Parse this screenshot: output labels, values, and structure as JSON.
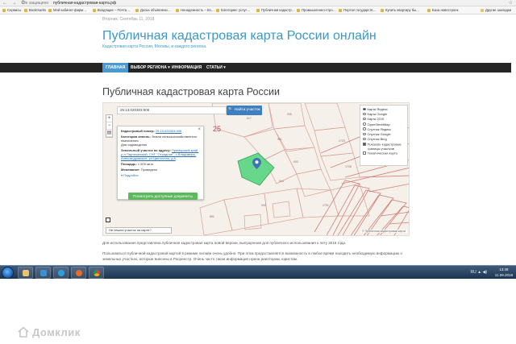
{
  "browser": {
    "nav_glyphs": "← → C",
    "secure_label": "Не защищено",
    "url": "публичная-кадастровая-карта.рф",
    "bookmarks": [
      "Сервисы",
      "Bookmarks",
      "Мой кабинет-фирм…",
      "Входящие – Почта…",
      "Доска объявлени…",
      "Ненадежность – Вз…",
      "Категории: услуг…",
      "Публичная кадастр…",
      "Промышленно-стро…",
      "Портал государств…",
      "Купить квартиру бы…",
      "База новостроек",
      "Другие закладки"
    ]
  },
  "header": {
    "date": "Вторник, Сентябрь 11, 2018",
    "site_title": "Публичная кадастровая карта России онлайн",
    "tagline": "Кадастровая карта России, Москвы, и каждого региона."
  },
  "nav": {
    "items": [
      "ГЛАВНАЯ",
      "ВЫБОР РЕГИОНА ▾",
      "ИНФОРМАЦИЯ",
      "СТАТЬИ ▾"
    ]
  },
  "content": {
    "title": "Публичная кадастровая карта России"
  },
  "map": {
    "search_value": "25:13:020303:906",
    "search_button": "Найти участок",
    "zoom_in": "+",
    "zoom_out": "−",
    "parcel_number": "25",
    "layers": [
      {
        "label": "Карта Яндекс",
        "on": true
      },
      {
        "label": "Карта Google",
        "on": false
      },
      {
        "label": "Карта 2GIS",
        "on": false
      },
      {
        "label": "OpenStreetMap",
        "on": false
      },
      {
        "label": "Спутник Яндекс",
        "on": false
      },
      {
        "label": "Спутник Google",
        "on": false
      },
      {
        "label": "Спутник Bing",
        "on": false
      }
    ],
    "checkbox_layers": [
      {
        "label": "Показать кадастровые границы участков",
        "on": true
      },
      {
        "label": "Тематическая карта",
        "on": false
      }
    ],
    "popup": {
      "cadastral_label": "Кадастровый номер:",
      "cadastral_value": "25:13:020303:906",
      "category_label": "Категория земель:",
      "category_value": "Земли сельскохозяйственного назначения",
      "usage_value": "Для садоводства",
      "address_label": "Земельный участок по адресу:",
      "address_value": "Приморский край, р-н Партизанский, СНТ \"Отрадное\", с.Владимиро-Александровское, ул.Цветочная, д.8",
      "area_label": "Площадь:",
      "area_value": "1 500 кв.м",
      "ownership_label": "Межевание:",
      "ownership_value": "Проведено",
      "more_link": "Подробно",
      "button_label": "Посмотреть доступные документы",
      "close": "×"
    },
    "bottom_link": "Не нашли участок на карте?",
    "copyright": "© Публичная кадастровая карта",
    "marker_color": "#3f74b5",
    "highlight_color": "#4cd27a"
  },
  "paragraphs": [
    "Для использования представлена публичная кадастровая карта новой версии, выпущенная для публичного использования к лету 2016 года.",
    "Пользоваться публичной кадастровой картой в режиме онлайн очень удобно. При этом предоставляется возможность в любое время находить необходимую информацию о земельных участках, которые внесены в Росреестр. Очень часто такая информация нужна риелторам, юристам."
  ],
  "taskbar": {
    "time": "13:49",
    "date": "11.09.2018",
    "tray_glyphs": "RU ▲ ◀)"
  },
  "watermark": "Домклик"
}
